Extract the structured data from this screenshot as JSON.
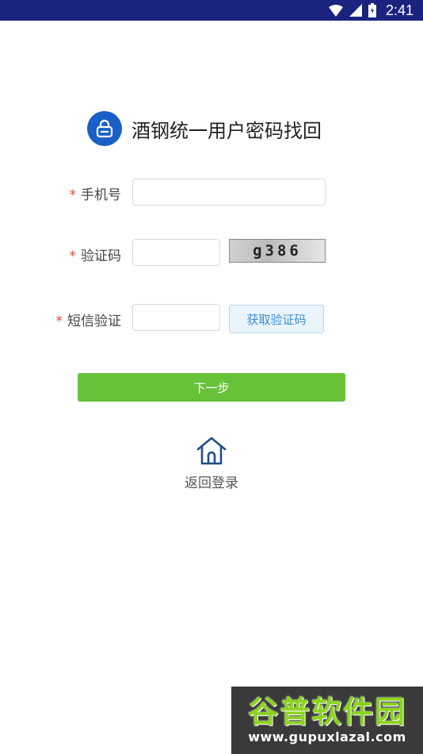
{
  "status_bar": {
    "time": "2:41",
    "icons": [
      "wifi-icon",
      "cell-signal-icon",
      "battery-icon"
    ],
    "background": "#1a237e"
  },
  "header": {
    "icon": "lock-icon",
    "title": "酒钢统一用户密码找回",
    "icon_color": "#1a5fc8"
  },
  "form": {
    "required_mark": "*",
    "phone": {
      "label": "手机号",
      "value": "",
      "placeholder": ""
    },
    "captcha": {
      "label": "验证码",
      "value": "",
      "placeholder": "",
      "image_text": "g386"
    },
    "sms": {
      "label": "短信验证",
      "value": "",
      "placeholder": "",
      "button_label": "获取验证码"
    }
  },
  "actions": {
    "next_label": "下一步",
    "next_color": "#67c23a",
    "back_label": "返回登录",
    "back_icon": "home-icon"
  },
  "watermark": {
    "title": "谷普软件园",
    "url": "www.gupuxlazal.com"
  }
}
